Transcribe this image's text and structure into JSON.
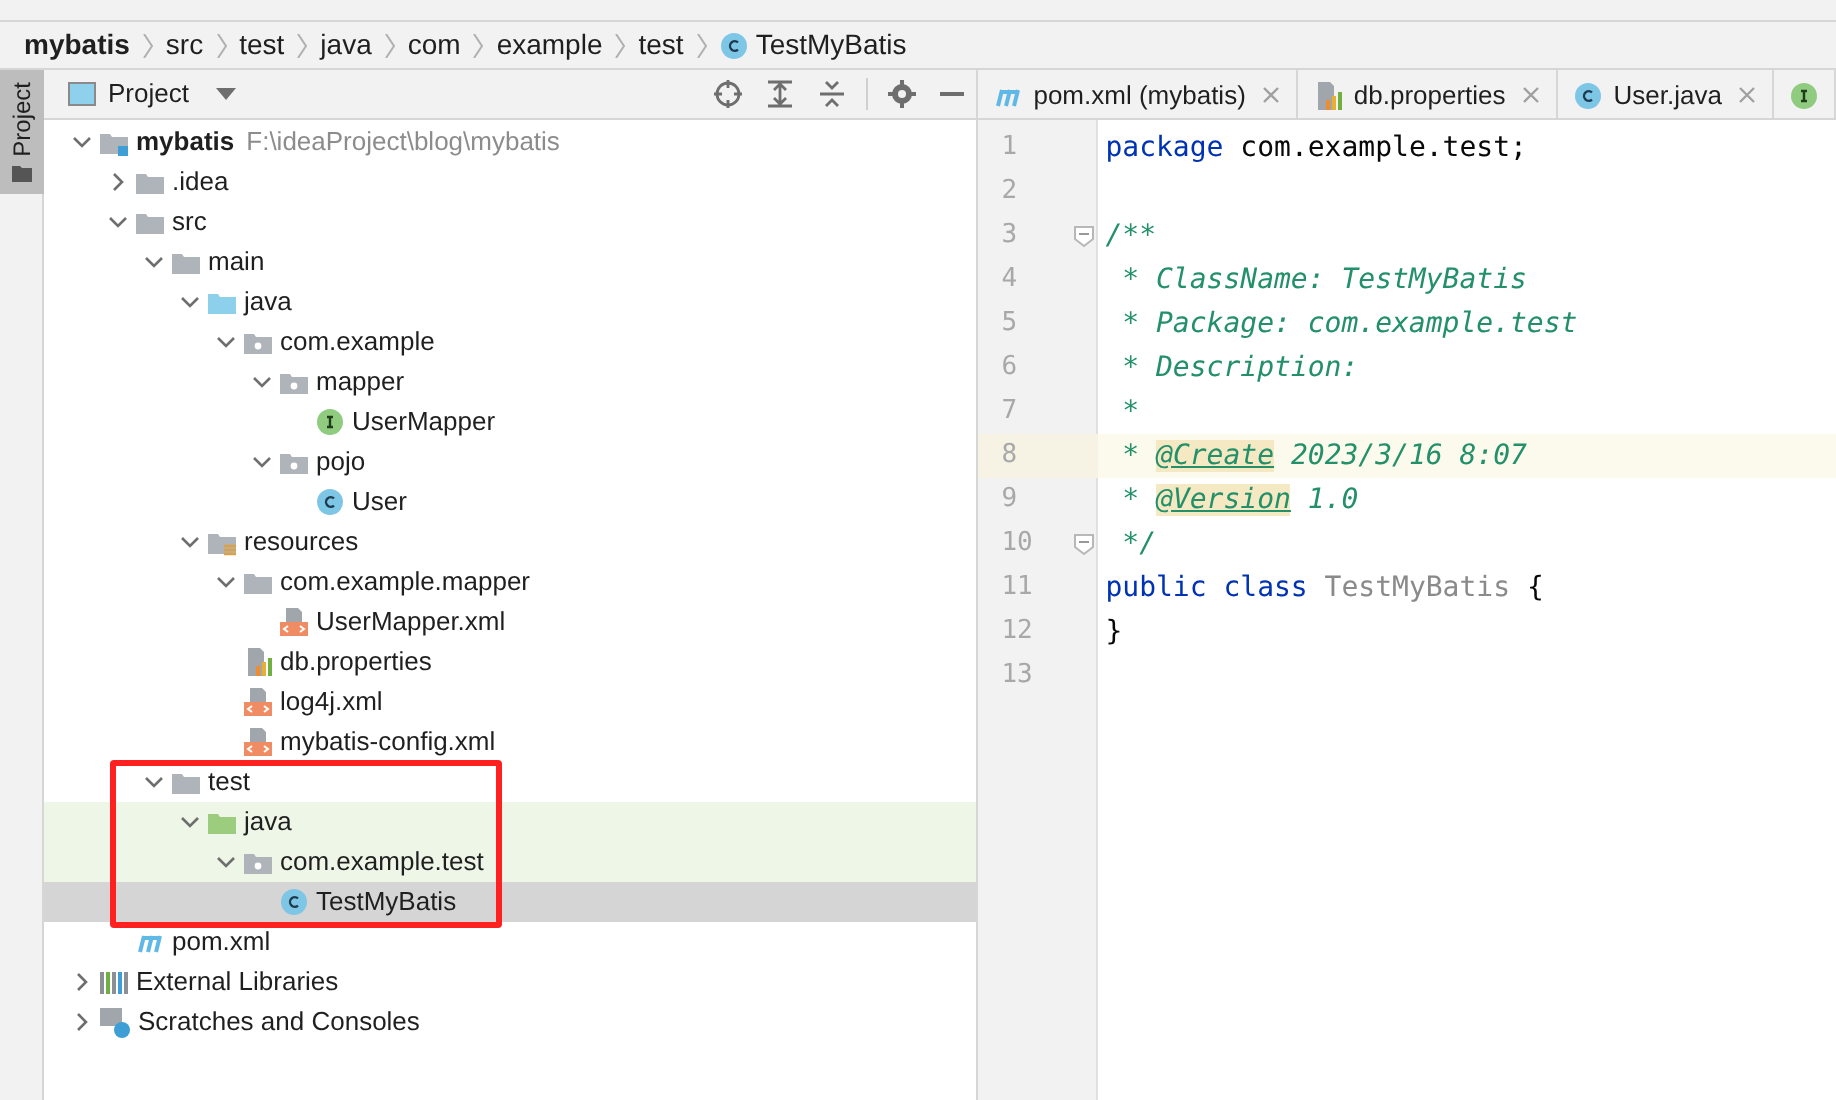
{
  "breadcrumb": [
    {
      "label": "mybatis"
    },
    {
      "label": "src"
    },
    {
      "label": "test"
    },
    {
      "label": "java"
    },
    {
      "label": "com"
    },
    {
      "label": "example"
    },
    {
      "label": "test"
    },
    {
      "label": "TestMyBatis",
      "kind": "class"
    }
  ],
  "side_tab": {
    "label": "Project"
  },
  "project_panel": {
    "title": "Project",
    "tree": [
      {
        "label": "mybatis",
        "kind": "module",
        "path": "F:\\ideaProject\\blog\\mybatis",
        "expanded": true,
        "children": [
          {
            "label": ".idea",
            "kind": "folder",
            "expanded": false
          },
          {
            "label": "src",
            "kind": "folder",
            "expanded": true,
            "children": [
              {
                "label": "main",
                "kind": "folder",
                "expanded": true,
                "children": [
                  {
                    "label": "java",
                    "kind": "source",
                    "expanded": true,
                    "children": [
                      {
                        "label": "com.example",
                        "kind": "package",
                        "expanded": true,
                        "children": [
                          {
                            "label": "mapper",
                            "kind": "package",
                            "expanded": true,
                            "children": [
                              {
                                "label": "UserMapper",
                                "kind": "interface"
                              }
                            ]
                          },
                          {
                            "label": "pojo",
                            "kind": "package",
                            "expanded": true,
                            "children": [
                              {
                                "label": "User",
                                "kind": "class"
                              }
                            ]
                          }
                        ]
                      }
                    ]
                  },
                  {
                    "label": "resources",
                    "kind": "resources",
                    "expanded": true,
                    "children": [
                      {
                        "label": "com.example.mapper",
                        "kind": "folder",
                        "expanded": true,
                        "children": [
                          {
                            "label": "UserMapper.xml",
                            "kind": "xml"
                          }
                        ]
                      },
                      {
                        "label": "db.properties",
                        "kind": "properties"
                      },
                      {
                        "label": "log4j.xml",
                        "kind": "xml"
                      },
                      {
                        "label": "mybatis-config.xml",
                        "kind": "xml"
                      }
                    ]
                  }
                ]
              },
              {
                "label": "test",
                "kind": "folder",
                "expanded": true,
                "children": [
                  {
                    "label": "java",
                    "kind": "test",
                    "expanded": true,
                    "highlighted": true,
                    "children": [
                      {
                        "label": "com.example.test",
                        "kind": "package",
                        "expanded": true,
                        "highlighted": true,
                        "children": [
                          {
                            "label": "TestMyBatis",
                            "kind": "class",
                            "selected": true
                          }
                        ]
                      }
                    ]
                  }
                ]
              }
            ]
          },
          {
            "label": "pom.xml",
            "kind": "maven"
          }
        ]
      },
      {
        "label": "External Libraries",
        "kind": "libraries",
        "expanded": false
      },
      {
        "label": "Scratches and Consoles",
        "kind": "scratches",
        "expanded": false
      }
    ]
  },
  "editor_tabs": [
    {
      "label": "pom.xml (mybatis)",
      "kind": "maven"
    },
    {
      "label": "db.properties",
      "kind": "properties"
    },
    {
      "label": "User.java",
      "kind": "class"
    },
    {
      "kind": "interface"
    }
  ],
  "code_lines": [
    {
      "number": "1",
      "tokens": [
        {
          "kind": "keyword",
          "text": "package"
        },
        {
          "kind": "plain",
          "text": " com.example.test;"
        }
      ]
    },
    {
      "number": "2"
    },
    {
      "number": "3",
      "fold": true,
      "tokens": [
        {
          "kind": "comment",
          "text": "/**"
        }
      ]
    },
    {
      "number": "4",
      "tokens": [
        {
          "kind": "comment",
          "text": " * ClassName: TestMyBatis"
        }
      ]
    },
    {
      "number": "5",
      "tokens": [
        {
          "kind": "comment",
          "text": " * Package: com.example.test"
        }
      ]
    },
    {
      "number": "6",
      "tokens": [
        {
          "kind": "comment",
          "text": " * Description:"
        }
      ]
    },
    {
      "number": "7",
      "tokens": [
        {
          "kind": "comment",
          "text": " *"
        }
      ]
    },
    {
      "number": "8",
      "current": true,
      "tokens": [
        {
          "kind": "comment",
          "text": " * "
        },
        {
          "kind": "tag",
          "text": "@Create"
        },
        {
          "kind": "comment",
          "text": " 2023/3/16 8:07"
        }
      ]
    },
    {
      "number": "9",
      "tokens": [
        {
          "kind": "comment",
          "text": " * "
        },
        {
          "kind": "tag",
          "text": "@Version"
        },
        {
          "kind": "comment",
          "text": " 1.0"
        }
      ]
    },
    {
      "number": "10",
      "fold": true,
      "tokens": [
        {
          "kind": "comment",
          "text": " */"
        }
      ]
    },
    {
      "number": "11",
      "tokens": [
        {
          "kind": "keyword",
          "text": "public class"
        },
        {
          "kind": "unused",
          "text": " TestMyBatis"
        },
        {
          "kind": "plain",
          "text": " {"
        }
      ]
    },
    {
      "number": "12",
      "tokens": [
        {
          "kind": "plain",
          "text": "}"
        }
      ]
    },
    {
      "number": "13"
    }
  ]
}
